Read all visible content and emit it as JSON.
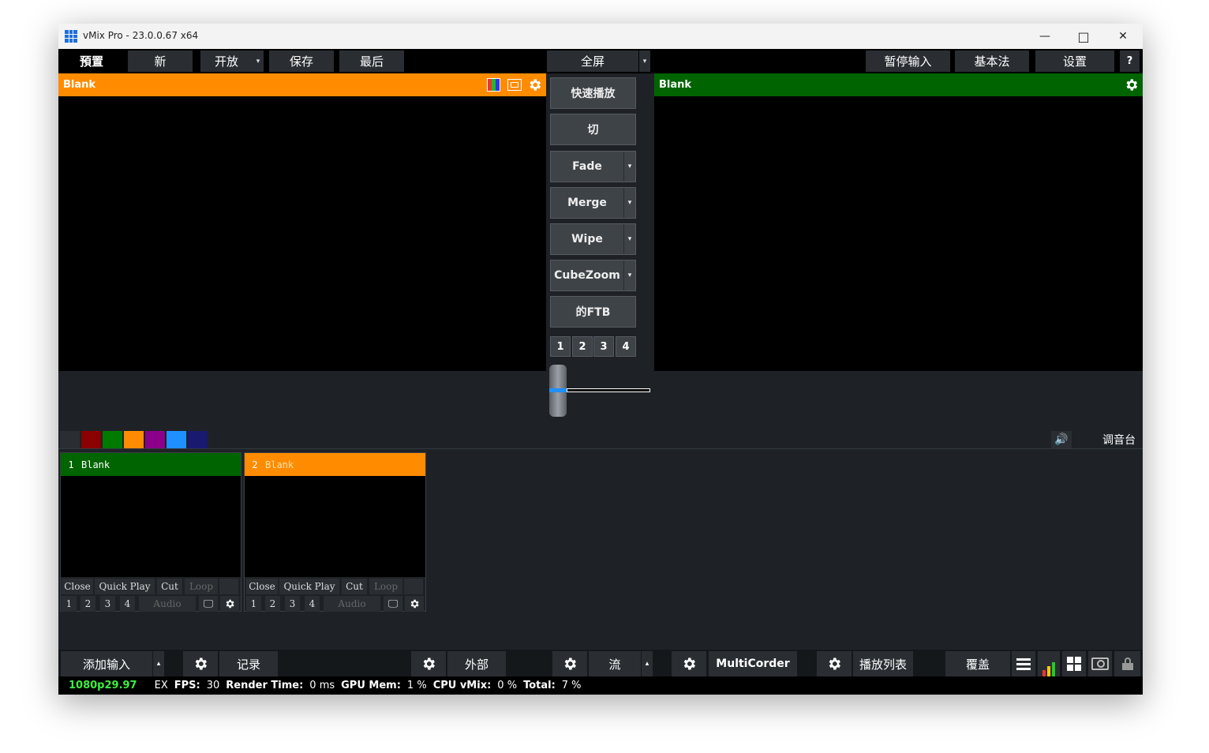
{
  "window": {
    "title": "vMix Pro - 23.0.0.67 x64",
    "minimize": "—",
    "maximize": "□",
    "close": "✕"
  },
  "toolbar": {
    "preview_label": "預置",
    "new_label": "新",
    "open_label": "开放",
    "save_label": "保存",
    "last_label": "最后",
    "fullscreen_label": "全屏",
    "pause_inputs_label": "暂停输入",
    "basic_label": "基本法",
    "settings_label": "设置",
    "help_label": "?"
  },
  "preview": {
    "title": "Blank",
    "color": "#ff8c00"
  },
  "output": {
    "title": "Blank",
    "color": "#006400"
  },
  "transitions": {
    "quickplay": "快速播放",
    "cut": "切",
    "fade": "Fade",
    "merge": "Merge",
    "wipe": "Wipe",
    "cubezoom": "CubeZoom",
    "ftb": "的FTB",
    "numbers": [
      "1",
      "2",
      "3",
      "4"
    ],
    "tbar_level": 0.5
  },
  "color_filters": [
    "#2a2e33",
    "#8b0000",
    "#007a00",
    "#ff8c00",
    "#8b008b",
    "#1e90ff",
    "#191970"
  ],
  "mixer_label": "调音台",
  "inputs": [
    {
      "number": "1",
      "title": "Blank",
      "color": "#006400",
      "text_color": "#ffffff",
      "controls": [
        "Close",
        "Quick Play",
        "Cut",
        "Loop"
      ],
      "layers": [
        "1",
        "2",
        "3",
        "4"
      ],
      "audio": "Audio"
    },
    {
      "number": "2",
      "title": "Blank",
      "color": "#ff8c00",
      "text_color": "#ffe0a8",
      "controls": [
        "Close",
        "Quick Play",
        "Cut",
        "Loop"
      ],
      "layers": [
        "1",
        "2",
        "3",
        "4"
      ],
      "audio": "Audio"
    }
  ],
  "bottom": {
    "add_input": "添加输入",
    "record": "记录",
    "external": "外部",
    "stream": "流",
    "multicorder": "MultiCorder",
    "playlist": "播放列表",
    "overlay": "覆盖"
  },
  "status": {
    "resolution": "1080p29.97",
    "ex": "EX",
    "fps_label": "FPS:",
    "fps": "30",
    "render_label": "Render Time:",
    "render": "0 ms",
    "gpu_label": "GPU Mem:",
    "gpu": "1 %",
    "cpu_label": "CPU vMix:",
    "cpu": "0 %",
    "total_label": "Total:",
    "total": "7 %"
  }
}
